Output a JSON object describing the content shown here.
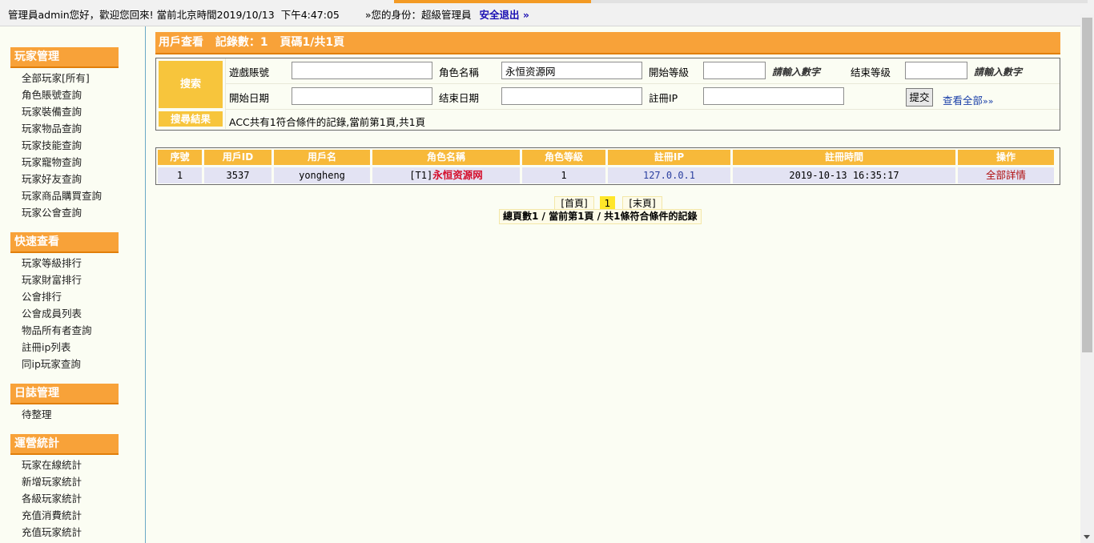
{
  "topbar": {
    "greeting": "管理員admin您好，歡迎您回來! 當前北京時間2019/10/13",
    "time": "下午4:47:05",
    "identity": "»您的身份：超級管理員",
    "logout": "安全退出 »"
  },
  "sidebar": {
    "groups": [
      {
        "title": "玩家管理",
        "items": [
          "全部玩家[所有]",
          "角色賬號查詢",
          "玩家裝備查詢",
          "玩家物品查詢",
          "玩家技能查詢",
          "玩家寵物查詢",
          "玩家好友查詢",
          "玩家商品購買查詢",
          "玩家公會查詢"
        ]
      },
      {
        "title": "快速查看",
        "items": [
          "玩家等級排行",
          "玩家財富排行",
          "公會排行",
          "公會成員列表",
          "物品所有者查詢",
          "註冊ip列表",
          "同ip玩家查詢"
        ]
      },
      {
        "title": "日誌管理",
        "items": [
          "待整理"
        ]
      },
      {
        "title": "運營統計",
        "items": [
          "玩家在線統計",
          "新增玩家統計",
          "各級玩家統計",
          "充值消費統計",
          "充值玩家統計"
        ]
      }
    ]
  },
  "main": {
    "title": "用戶查看",
    "records": "記錄數：1",
    "pages": "頁碼1/共1頁"
  },
  "search": {
    "label": "搜索",
    "game_account_label": "遊戲賬號",
    "game_account_value": "",
    "role_name_label": "角色名稱",
    "role_name_value": "永恒资源网",
    "start_level_label": "開始等級",
    "start_level_value": "",
    "start_level_hint": "請輸入數字",
    "end_level_label": "结束等级",
    "end_level_value": "",
    "end_level_hint": "請輸入數字",
    "start_date_label": "開始日期",
    "start_date_value": "",
    "end_date_label": "结束日期",
    "end_date_value": "",
    "reg_ip_label": "註冊IP",
    "reg_ip_value": "",
    "submit": "提交",
    "view_all": "查看全部",
    "view_all_arrows": "»»",
    "result_label": "搜尋結果",
    "result_text": "ACC共有1符合條件的記錄,當前第1頁,共1頁"
  },
  "table": {
    "headers": [
      "序號",
      "用戶ID",
      "用戶名",
      "角色名稱",
      "角色等級",
      "註冊IP",
      "註冊時間",
      "操作"
    ],
    "rows": [
      {
        "index": "1",
        "user_id": "3537",
        "username": "yongheng",
        "role_prefix": "[T1]",
        "role_name": "永恒资源网",
        "level": "1",
        "reg_ip": "127.0.0.1",
        "reg_time": "2019-10-13 16:35:17",
        "action": "全部詳情"
      }
    ]
  },
  "pager": {
    "first": "[首頁]",
    "current": "1",
    "last": "[末頁]",
    "summary": "總頁數1 / 當前第1頁 / 共1條符合條件的記錄"
  },
  "colors": {
    "accent": "#f8a239",
    "label_yellow": "#f7c53c",
    "page_bg": "#fbfdf3",
    "logout_link": "#1a0fb3"
  }
}
